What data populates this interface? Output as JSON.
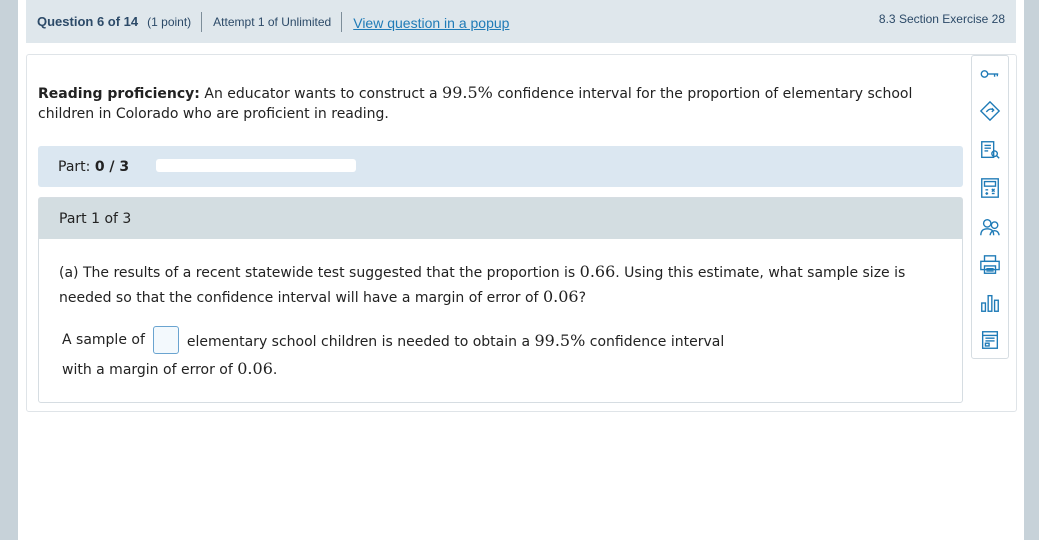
{
  "header": {
    "question_num": "Question 6 of 14",
    "points": "(1 point)",
    "attempt": "Attempt 1 of Unlimited",
    "popup_link": "View question in a popup",
    "section": "8.3 Section Exercise 28"
  },
  "prompt": {
    "bold_lead": "Reading proficiency:",
    "text_before": " An educator wants to construct a ",
    "confidence": "99.5%",
    "text_after": " confidence interval for the proportion of elementary school children in Colorado who are proficient in reading."
  },
  "progress": {
    "label": "Part: ",
    "value": "0 / 3",
    "fraction": 0
  },
  "part": {
    "header": "Part 1 of 3",
    "q_a": "(a) The results of a recent statewide test suggested that the proportion is ",
    "q_p": "0.66",
    "q_b": ". Using this estimate, what sample size is needed so that the confidence interval will have a margin of error of ",
    "q_moe": "0.06",
    "q_c": "?",
    "ans_a": "A sample of",
    "ans_b": "elementary school children is needed to obtain a ",
    "ans_conf": "99.5%",
    "ans_c": " confidence interval",
    "ans_d": "with a margin of error of ",
    "ans_moe": "0.06",
    "ans_e": "."
  },
  "tools": [
    "key-icon",
    "tag-icon",
    "notes-icon",
    "calculator-icon",
    "help-icon",
    "print-icon",
    "chart-icon",
    "table-icon"
  ],
  "colors": {
    "accent": "#1f7bb7",
    "header_bg": "#dfe7ec",
    "progress_bg": "#dbe7f1"
  }
}
